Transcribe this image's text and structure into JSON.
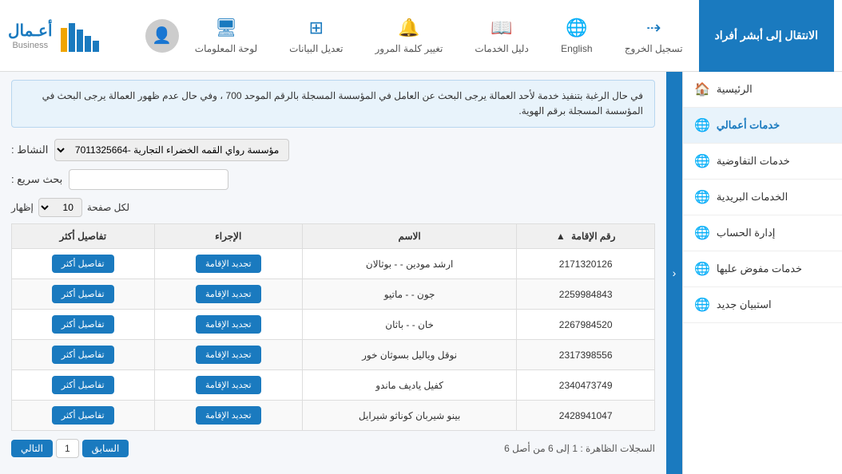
{
  "topnav": {
    "highlight_btn": "الانتقال إلى أبشر أفراد",
    "logout_label": "تسجيل الخروج",
    "logout_icon": "⇢",
    "english_label": "English",
    "english_icon": "🌐",
    "services_guide_label": "دليل الخدمات",
    "services_guide_icon": "📖",
    "change_pass_label": "تغيير كلمة المرور",
    "change_pass_icon": "🔔",
    "update_data_label": "تعديل البيانات",
    "update_data_icon": "⊞",
    "dashboard_label": "لوحة المعلومات",
    "dashboard_icon": "🖥",
    "logo_main": "أعـمال",
    "logo_sub": "Business"
  },
  "sidebar": {
    "items": [
      {
        "label": "الرئيسية",
        "icon": "🏠",
        "active": false
      },
      {
        "label": "خدمات أعمالي",
        "icon": "🌐",
        "active": true
      },
      {
        "label": "خدمات التفاوضية",
        "icon": "🌐",
        "active": false
      },
      {
        "label": "الخدمات البريدية",
        "icon": "🌐",
        "active": false
      },
      {
        "label": "إدارة الحساب",
        "icon": "🌐",
        "active": false
      },
      {
        "label": "خدمات مفوض عليها",
        "icon": "🌐",
        "active": false
      },
      {
        "label": "استبيان جديد",
        "icon": "🌐",
        "active": false
      }
    ]
  },
  "content": {
    "info_text": "في حال الرغبة بتنفيذ خدمة لأحد العمالة يرجى البحث عن العامل في المؤسسة المسجلة بالرقم الموحد 700 ، وفي حال عدم ظهور العمالة يرجى البحث في المؤسسة المسجلة برقم الهوية.",
    "activity_label": "النشاط :",
    "activity_value": "مؤسسة رواي القمه الخضراء التجارية -7011325664",
    "search_label": "بحث سريع :",
    "search_placeholder": "",
    "perpage_label": "إظهار",
    "perpage_label2": "لكل صفحة",
    "perpage_value": "10",
    "table": {
      "headers": [
        "رقم الإقامة",
        "الاسم",
        "الإجراء",
        "تفاصيل أكثر"
      ],
      "rows": [
        {
          "iqama": "2171320126",
          "name": "ارشد مودين - - بوثالان",
          "action": "تجديد الإقامة",
          "details": "تفاصيل أكثر"
        },
        {
          "iqama": "2259984843",
          "name": "جون - - ماتيو",
          "action": "تجديد الإقامة",
          "details": "تفاصيل أكثر"
        },
        {
          "iqama": "2267984520",
          "name": "خان - - باثان",
          "action": "تجديد الإقامة",
          "details": "تفاصيل أكثر"
        },
        {
          "iqama": "2317398556",
          "name": "نوقل وياليل بسوثان خور",
          "action": "تجديد الإقامة",
          "details": "تفاصيل أكثر"
        },
        {
          "iqama": "2340473749",
          "name": "كفيل ياديف ماندو",
          "action": "تجديد الإقامة",
          "details": "تفاصيل أكثر"
        },
        {
          "iqama": "2428941047",
          "name": "بينو شيربان كوناثو شيرايل",
          "action": "تجديد الإقامة",
          "details": "تفاصيل أكثر"
        }
      ]
    },
    "pagination": {
      "info": "السجلات الظاهرة : 1 إلى 6 من أصل 6",
      "prev_label": "السابق",
      "current_page": "1",
      "next_label": "التالي"
    }
  }
}
